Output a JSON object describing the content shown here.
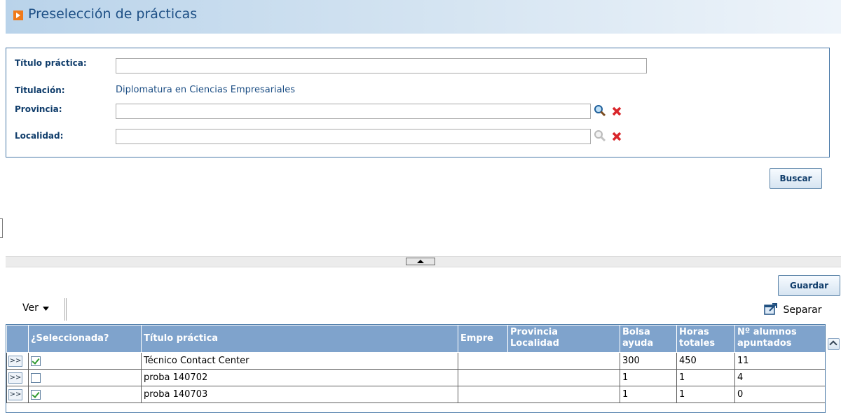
{
  "page": {
    "title": "Preselección de prácticas"
  },
  "form": {
    "titulo_label": "Título práctica:",
    "titulo_value": "",
    "titulacion_label": "Titulación:",
    "titulacion_value": "Diplomatura en Ciencias Empresariales",
    "provincia_label": "Provincia:",
    "provincia_value": "",
    "localidad_label": "Localidad:",
    "localidad_value": ""
  },
  "buttons": {
    "buscar": "Buscar",
    "guardar": "Guardar"
  },
  "toolbar": {
    "ver": "Ver",
    "separar": "Separar"
  },
  "grid": {
    "headers": {
      "seleccionada": "¿Seleccionada?",
      "titulo": "Título práctica",
      "empresa": "Empre",
      "provincia": "Provincia",
      "localidad": "Localidad",
      "bolsa1": "Bolsa",
      "bolsa2": "ayuda",
      "horas1": "Horas",
      "horas2": "totales",
      "alumnos1": "Nº alumnos",
      "alumnos2": "apuntados"
    },
    "expand_label": ">>",
    "rows": [
      {
        "selected": true,
        "titulo": "Técnico Contact Center",
        "bolsa": "300",
        "horas": "450",
        "alumnos": "11"
      },
      {
        "selected": false,
        "titulo": "proba 140702",
        "bolsa": "1",
        "horas": "1",
        "alumnos": "4"
      },
      {
        "selected": true,
        "titulo": "proba 140703",
        "bolsa": "1",
        "horas": "1",
        "alumnos": "0"
      }
    ]
  },
  "icons": {
    "marker": "orange-arrow-icon",
    "search": "magnifier-icon",
    "clear": "red-x-icon",
    "separar": "detach-window-icon",
    "dropdown": "caret-down-icon"
  },
  "colors": {
    "accent": "#1d4f85",
    "header_bg": "#7fa3cc",
    "marker": "#f07a1a",
    "clear": "#d9262b"
  }
}
